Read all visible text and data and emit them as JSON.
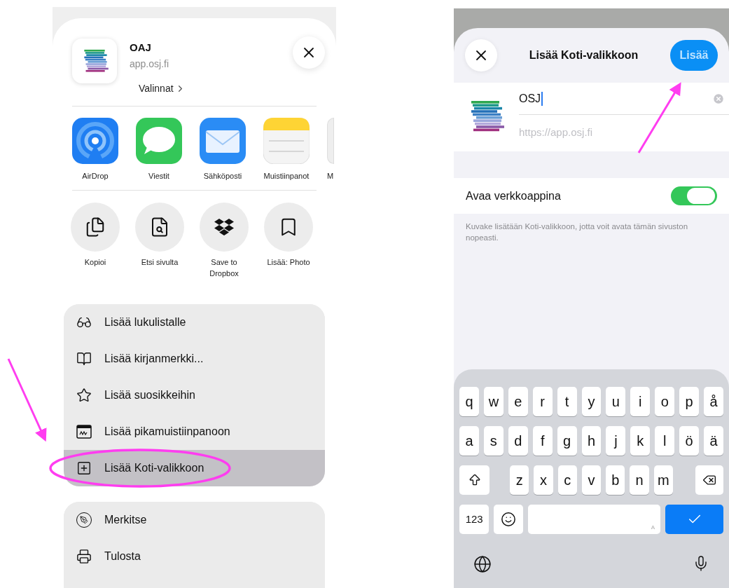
{
  "share_sheet": {
    "app_title": "OAJ",
    "app_url": "app.osj.fi",
    "options_link": "Valinnat",
    "apps": [
      {
        "label": "AirDrop",
        "kind": "airdrop"
      },
      {
        "label": "Viestit",
        "kind": "messages"
      },
      {
        "label": "Sähköposti",
        "kind": "mail"
      },
      {
        "label": "Muistiinpanot",
        "kind": "notes"
      },
      {
        "label": "M",
        "kind": "partial"
      }
    ],
    "actions": [
      {
        "label": "Kopioi",
        "kind": "copy"
      },
      {
        "label": "Etsi sivulta",
        "kind": "find"
      },
      {
        "label": "Save to Dropbox",
        "kind": "dropbox"
      },
      {
        "label": "Lisää: Photo",
        "kind": "bookmark"
      }
    ],
    "menu_groups": [
      {
        "items": [
          {
            "label": "Lisää lukulistalle",
            "kind": "glasses",
            "selected": false
          },
          {
            "label": "Lisää kirjanmerkki...",
            "kind": "book",
            "selected": false
          },
          {
            "label": "Lisää suosikkeihin",
            "kind": "star",
            "selected": false
          },
          {
            "label": "Lisää pikamuistiinpanoon",
            "kind": "quicknote",
            "selected": false
          },
          {
            "label": "Lisää Koti-valikkoon",
            "kind": "plus",
            "selected": true
          }
        ]
      },
      {
        "items": [
          {
            "label": "Merkitse",
            "kind": "markup",
            "selected": false
          },
          {
            "label": "Tulosta",
            "kind": "print",
            "selected": false
          }
        ]
      }
    ]
  },
  "add_to_home": {
    "title": "Lisää Koti-valikkoon",
    "add_button": "Lisää",
    "name_value": "OSJ",
    "url_placeholder": "https://app.osj.fi",
    "web_app_toggle": {
      "label": "Avaa verkkoappina",
      "on": true
    },
    "footnote": "Kuvake lisätään Koti-valikkoon, jotta voit avata tämän sivuston nopeasti.",
    "keyboard": {
      "rows": [
        [
          "q",
          "w",
          "e",
          "r",
          "t",
          "y",
          "u",
          "i",
          "o",
          "p",
          "å"
        ],
        [
          "a",
          "s",
          "d",
          "f",
          "g",
          "h",
          "j",
          "k",
          "l",
          "ö",
          "ä"
        ],
        [
          "",
          "",
          "z",
          "x",
          "c",
          "v",
          "b",
          "n",
          "m",
          "",
          ""
        ]
      ],
      "number_key": "123",
      "space_hint": "A"
    }
  }
}
